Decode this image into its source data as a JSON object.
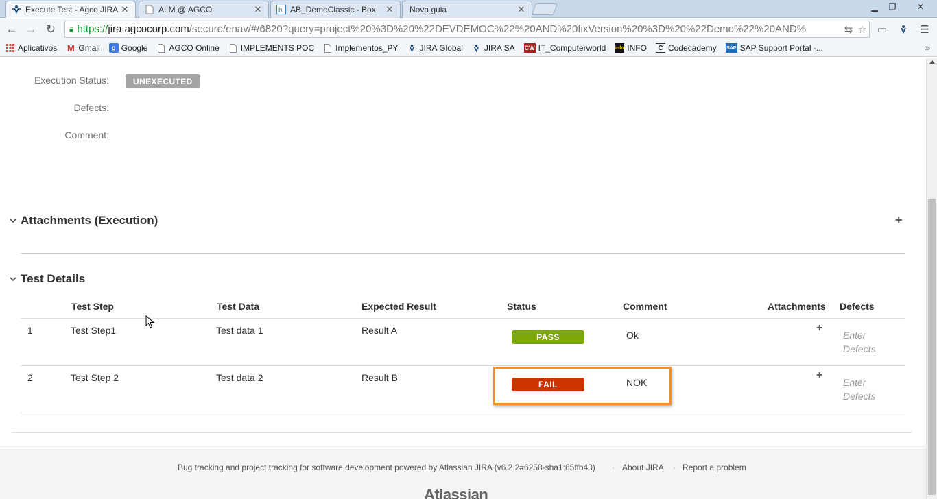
{
  "browser": {
    "tabs": [
      {
        "title": "Execute Test - Agco JIRA",
        "favicon": "jira-icon",
        "active": true
      },
      {
        "title": "ALM @ AGCO",
        "favicon": "page-icon",
        "active": false
      },
      {
        "title": "AB_DemoClassic - Box",
        "favicon": "box-icon",
        "active": false
      },
      {
        "title": "Nova guia",
        "favicon": "none",
        "active": false
      }
    ],
    "url_scheme": "https://",
    "url_host": "jira.agcocorp.com",
    "url_rest": "/secure/enav/#/6820?query=project%20%3D%20%22DEVDEMOC%22%20AND%20fixVersion%20%3D%20%22Demo%22%20AND%",
    "bookmarks": [
      {
        "label": "Aplicativos",
        "icon": "apps-grid-icon"
      },
      {
        "label": "Gmail",
        "icon": "gmail-icon"
      },
      {
        "label": "Google",
        "icon": "google-icon"
      },
      {
        "label": "AGCO Online",
        "icon": "page-icon"
      },
      {
        "label": "IMPLEMENTS POC",
        "icon": "page-icon"
      },
      {
        "label": "Implementos_PY",
        "icon": "page-icon"
      },
      {
        "label": "JIRA Global",
        "icon": "jira-icon"
      },
      {
        "label": "JIRA SA",
        "icon": "jira-icon"
      },
      {
        "label": "IT_Computerworld",
        "icon": "cw-icon"
      },
      {
        "label": "INFO",
        "icon": "info-icon"
      },
      {
        "label": "Codecademy",
        "icon": "codecademy-icon"
      },
      {
        "label": "SAP Support Portal -...",
        "icon": "sap-icon"
      }
    ],
    "bookmarks_overflow": "»"
  },
  "execution": {
    "status_label": "Execution Status:",
    "status_value": "UNEXECUTED",
    "defects_label": "Defects:",
    "comment_label": "Comment:"
  },
  "attachments_section": {
    "title": "Attachments (Execution)"
  },
  "test_details": {
    "title": "Test Details",
    "columns": {
      "step": "Test Step",
      "data": "Test Data",
      "expected": "Expected Result",
      "status": "Status",
      "comment": "Comment",
      "attachments": "Attachments",
      "defects": "Defects"
    },
    "rows": [
      {
        "num": "1",
        "step": "Test Step1",
        "data": "Test data 1",
        "expected": "Result A",
        "status": "PASS",
        "comment": "Ok",
        "defects_line1": "Enter",
        "defects_line2": "Defects"
      },
      {
        "num": "2",
        "step": "Test Step 2",
        "data": "Test data 2",
        "expected": "Result B",
        "status": "FAIL",
        "comment": "NOK",
        "defects_line1": "Enter",
        "defects_line2": "Defects"
      }
    ]
  },
  "footer": {
    "powered_by": "Bug tracking and project tracking for software development powered by Atlassian JIRA (v6.2.2#6258-sha1:65ffb43)",
    "about": "About JIRA",
    "report": "Report a problem",
    "separator": "·",
    "logo": "Atlassian"
  },
  "colors": {
    "pass": "#7ea80a",
    "fail": "#cc3300",
    "highlight": "#f0902a",
    "unexecuted": "#a5a5a5"
  }
}
